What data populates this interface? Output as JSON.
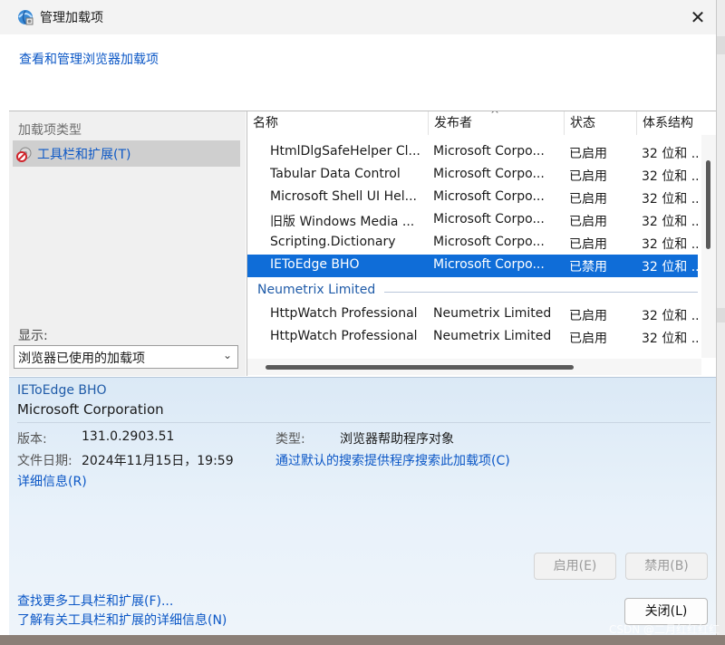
{
  "window": {
    "title": "管理加载项",
    "close_glyph": "✕"
  },
  "header": {
    "link": "查看和管理浏览器加载项"
  },
  "left": {
    "heading": "加载项类型",
    "items": [
      {
        "label": "工具栏和扩展(T)",
        "icon": "no-entry-gear-icon"
      }
    ],
    "show_label": "显示:",
    "show_select": {
      "value": "浏览器已使用的加载项",
      "chevron": "⌄"
    }
  },
  "list": {
    "columns": [
      "名称",
      "发布者",
      "状态",
      "体系结构"
    ],
    "sort_glyph": "^",
    "rows_top": [
      {
        "name": "HtmlDlgSafeHelper Cl...",
        "publisher": "Microsoft Corpo...",
        "status": "已启用",
        "arch": "32 位和 ..."
      },
      {
        "name": "Tabular Data Control",
        "publisher": "Microsoft Corpo...",
        "status": "已启用",
        "arch": "32 位和 ..."
      },
      {
        "name": "Microsoft Shell UI Hel...",
        "publisher": "Microsoft Corpo...",
        "status": "已启用",
        "arch": "32 位和 ..."
      },
      {
        "name": "旧版 Windows Media ...",
        "publisher": "Microsoft Corpo...",
        "status": "已启用",
        "arch": "32 位和 ..."
      },
      {
        "name": "Scripting.Dictionary",
        "publisher": "Microsoft Corpo...",
        "status": "已启用",
        "arch": "32 位和 ..."
      },
      {
        "name": "IEToEdge BHO",
        "publisher": "Microsoft Corpo...",
        "status": "已禁用",
        "arch": "32 位和 ..."
      }
    ],
    "group_label": "Neumetrix Limited",
    "rows_bottom": [
      {
        "name": "HttpWatch Professional",
        "publisher": "Neumetrix Limited",
        "status": "已启用",
        "arch": "32 位和 ..."
      },
      {
        "name": "HttpWatch Professional",
        "publisher": "Neumetrix Limited",
        "status": "已启用",
        "arch": "32 位和 ..."
      }
    ]
  },
  "details": {
    "name": "IEToEdge BHO",
    "publisher": "Microsoft Corporation",
    "version_label": "版本:",
    "version": "131.0.2903.51",
    "date_label": "文件日期:",
    "date": "2024年11月15日，19:59",
    "type_label": "类型:",
    "type": "浏览器帮助程序对象",
    "search_link": "通过默认的搜索提供程序搜索此加载项(C)",
    "more_info": "详细信息(R)",
    "enable_btn": "启用(E)",
    "disable_btn": "禁用(B)"
  },
  "footer": {
    "find_more": "查找更多工具栏和扩展(F)...",
    "learn_more": "了解有关工具栏和扩展的详细信息(N)",
    "close_btn": "关闭(L)"
  },
  "watermark": "CSDN @二月红红红红"
}
